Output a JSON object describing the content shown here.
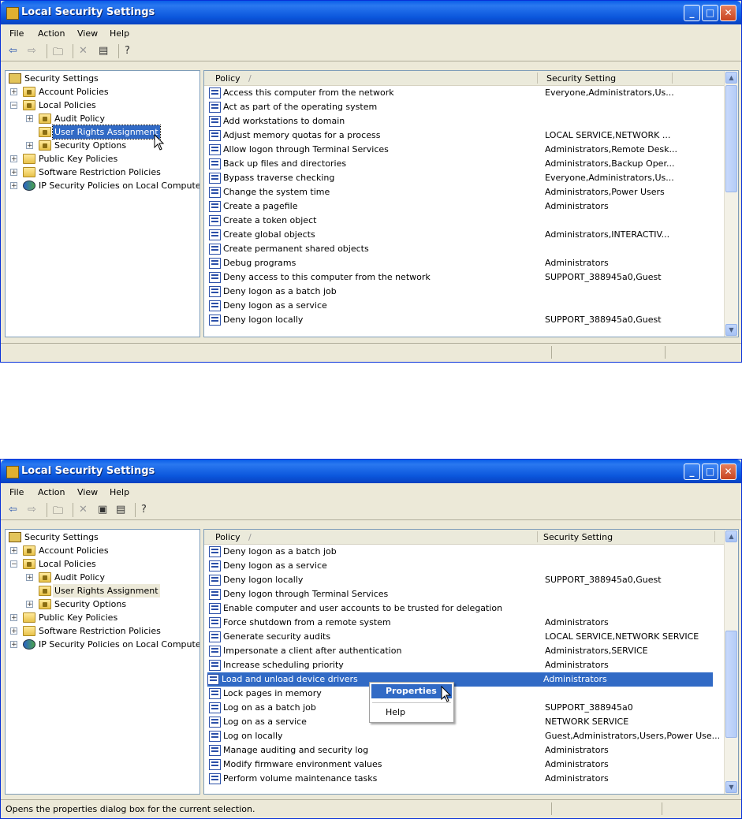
{
  "window1": {
    "title": "Local Security Settings",
    "menu": [
      "File",
      "Action",
      "View",
      "Help"
    ],
    "tree": {
      "root": "Security Settings",
      "account_policies": "Account Policies",
      "local_policies": "Local Policies",
      "audit_policy": "Audit Policy",
      "user_rights": "User Rights Assignment",
      "security_options": "Security Options",
      "public_key": "Public Key Policies",
      "software_restriction": "Software Restriction Policies",
      "ip_security": "IP Security Policies on Local Computer"
    },
    "columns": {
      "policy": "Policy",
      "sort": "/",
      "setting": "Security Setting"
    },
    "rows": [
      {
        "policy": "Access this computer from the network",
        "setting": "Everyone,Administrators,Us..."
      },
      {
        "policy": "Act as part of the operating system",
        "setting": ""
      },
      {
        "policy": "Add workstations to domain",
        "setting": ""
      },
      {
        "policy": "Adjust memory quotas for a process",
        "setting": "LOCAL SERVICE,NETWORK ..."
      },
      {
        "policy": "Allow logon through Terminal Services",
        "setting": "Administrators,Remote Desk..."
      },
      {
        "policy": "Back up files and directories",
        "setting": "Administrators,Backup Oper..."
      },
      {
        "policy": "Bypass traverse checking",
        "setting": "Everyone,Administrators,Us..."
      },
      {
        "policy": "Change the system time",
        "setting": "Administrators,Power Users"
      },
      {
        "policy": "Create a pagefile",
        "setting": "Administrators"
      },
      {
        "policy": "Create a token object",
        "setting": ""
      },
      {
        "policy": "Create global objects",
        "setting": "Administrators,INTERACTIV..."
      },
      {
        "policy": "Create permanent shared objects",
        "setting": ""
      },
      {
        "policy": "Debug programs",
        "setting": "Administrators"
      },
      {
        "policy": "Deny access to this computer from the network",
        "setting": "SUPPORT_388945a0,Guest"
      },
      {
        "policy": "Deny logon as a batch job",
        "setting": ""
      },
      {
        "policy": "Deny logon as a service",
        "setting": ""
      },
      {
        "policy": "Deny logon locally",
        "setting": "SUPPORT_388945a0,Guest"
      }
    ],
    "status": ""
  },
  "window2": {
    "title": "Local Security Settings",
    "menu": [
      "File",
      "Action",
      "View",
      "Help"
    ],
    "tree": {
      "root": "Security Settings",
      "account_policies": "Account Policies",
      "local_policies": "Local Policies",
      "audit_policy": "Audit Policy",
      "user_rights": "User Rights Assignment",
      "security_options": "Security Options",
      "public_key": "Public Key Policies",
      "software_restriction": "Software Restriction Policies",
      "ip_security": "IP Security Policies on Local Computer"
    },
    "columns": {
      "policy": "Policy",
      "sort": "/",
      "setting": "Security Setting"
    },
    "rows": [
      {
        "policy": "Deny logon as a batch job",
        "setting": ""
      },
      {
        "policy": "Deny logon as a service",
        "setting": ""
      },
      {
        "policy": "Deny logon locally",
        "setting": "SUPPORT_388945a0,Guest"
      },
      {
        "policy": "Deny logon through Terminal Services",
        "setting": ""
      },
      {
        "policy": "Enable computer and user accounts to be trusted for delegation",
        "setting": ""
      },
      {
        "policy": "Force shutdown from a remote system",
        "setting": "Administrators"
      },
      {
        "policy": "Generate security audits",
        "setting": "LOCAL SERVICE,NETWORK SERVICE"
      },
      {
        "policy": "Impersonate a client after authentication",
        "setting": "Administrators,SERVICE"
      },
      {
        "policy": "Increase scheduling priority",
        "setting": "Administrators"
      },
      {
        "policy": "Load and unload device drivers",
        "setting": "Administrators"
      },
      {
        "policy": "Lock pages in memory",
        "setting": ""
      },
      {
        "policy": "Log on as a batch job",
        "setting": "SUPPORT_388945a0"
      },
      {
        "policy": "Log on as a service",
        "setting": "NETWORK SERVICE"
      },
      {
        "policy": "Log on locally",
        "setting": "Guest,Administrators,Users,Power Use..."
      },
      {
        "policy": "Manage auditing and security log",
        "setting": "Administrators"
      },
      {
        "policy": "Modify firmware environment values",
        "setting": "Administrators"
      },
      {
        "policy": "Perform volume maintenance tasks",
        "setting": "Administrators"
      }
    ],
    "context_menu": {
      "properties": "Properties",
      "help": "Help"
    },
    "status": "Opens the properties dialog box for the current selection."
  },
  "icons": {
    "toolbar1": [
      "back-icon",
      "forward-icon",
      "up-folder-icon",
      "delete-icon",
      "export-icon",
      "help-icon"
    ],
    "toolbar2": [
      "back-icon",
      "forward-icon",
      "up-folder-icon",
      "delete-icon",
      "properties-icon",
      "export-icon",
      "help-icon"
    ]
  },
  "colors": {
    "titlebar": "#0a5ee8",
    "selection": "#316ac5",
    "chrome": "#ece9d8"
  }
}
